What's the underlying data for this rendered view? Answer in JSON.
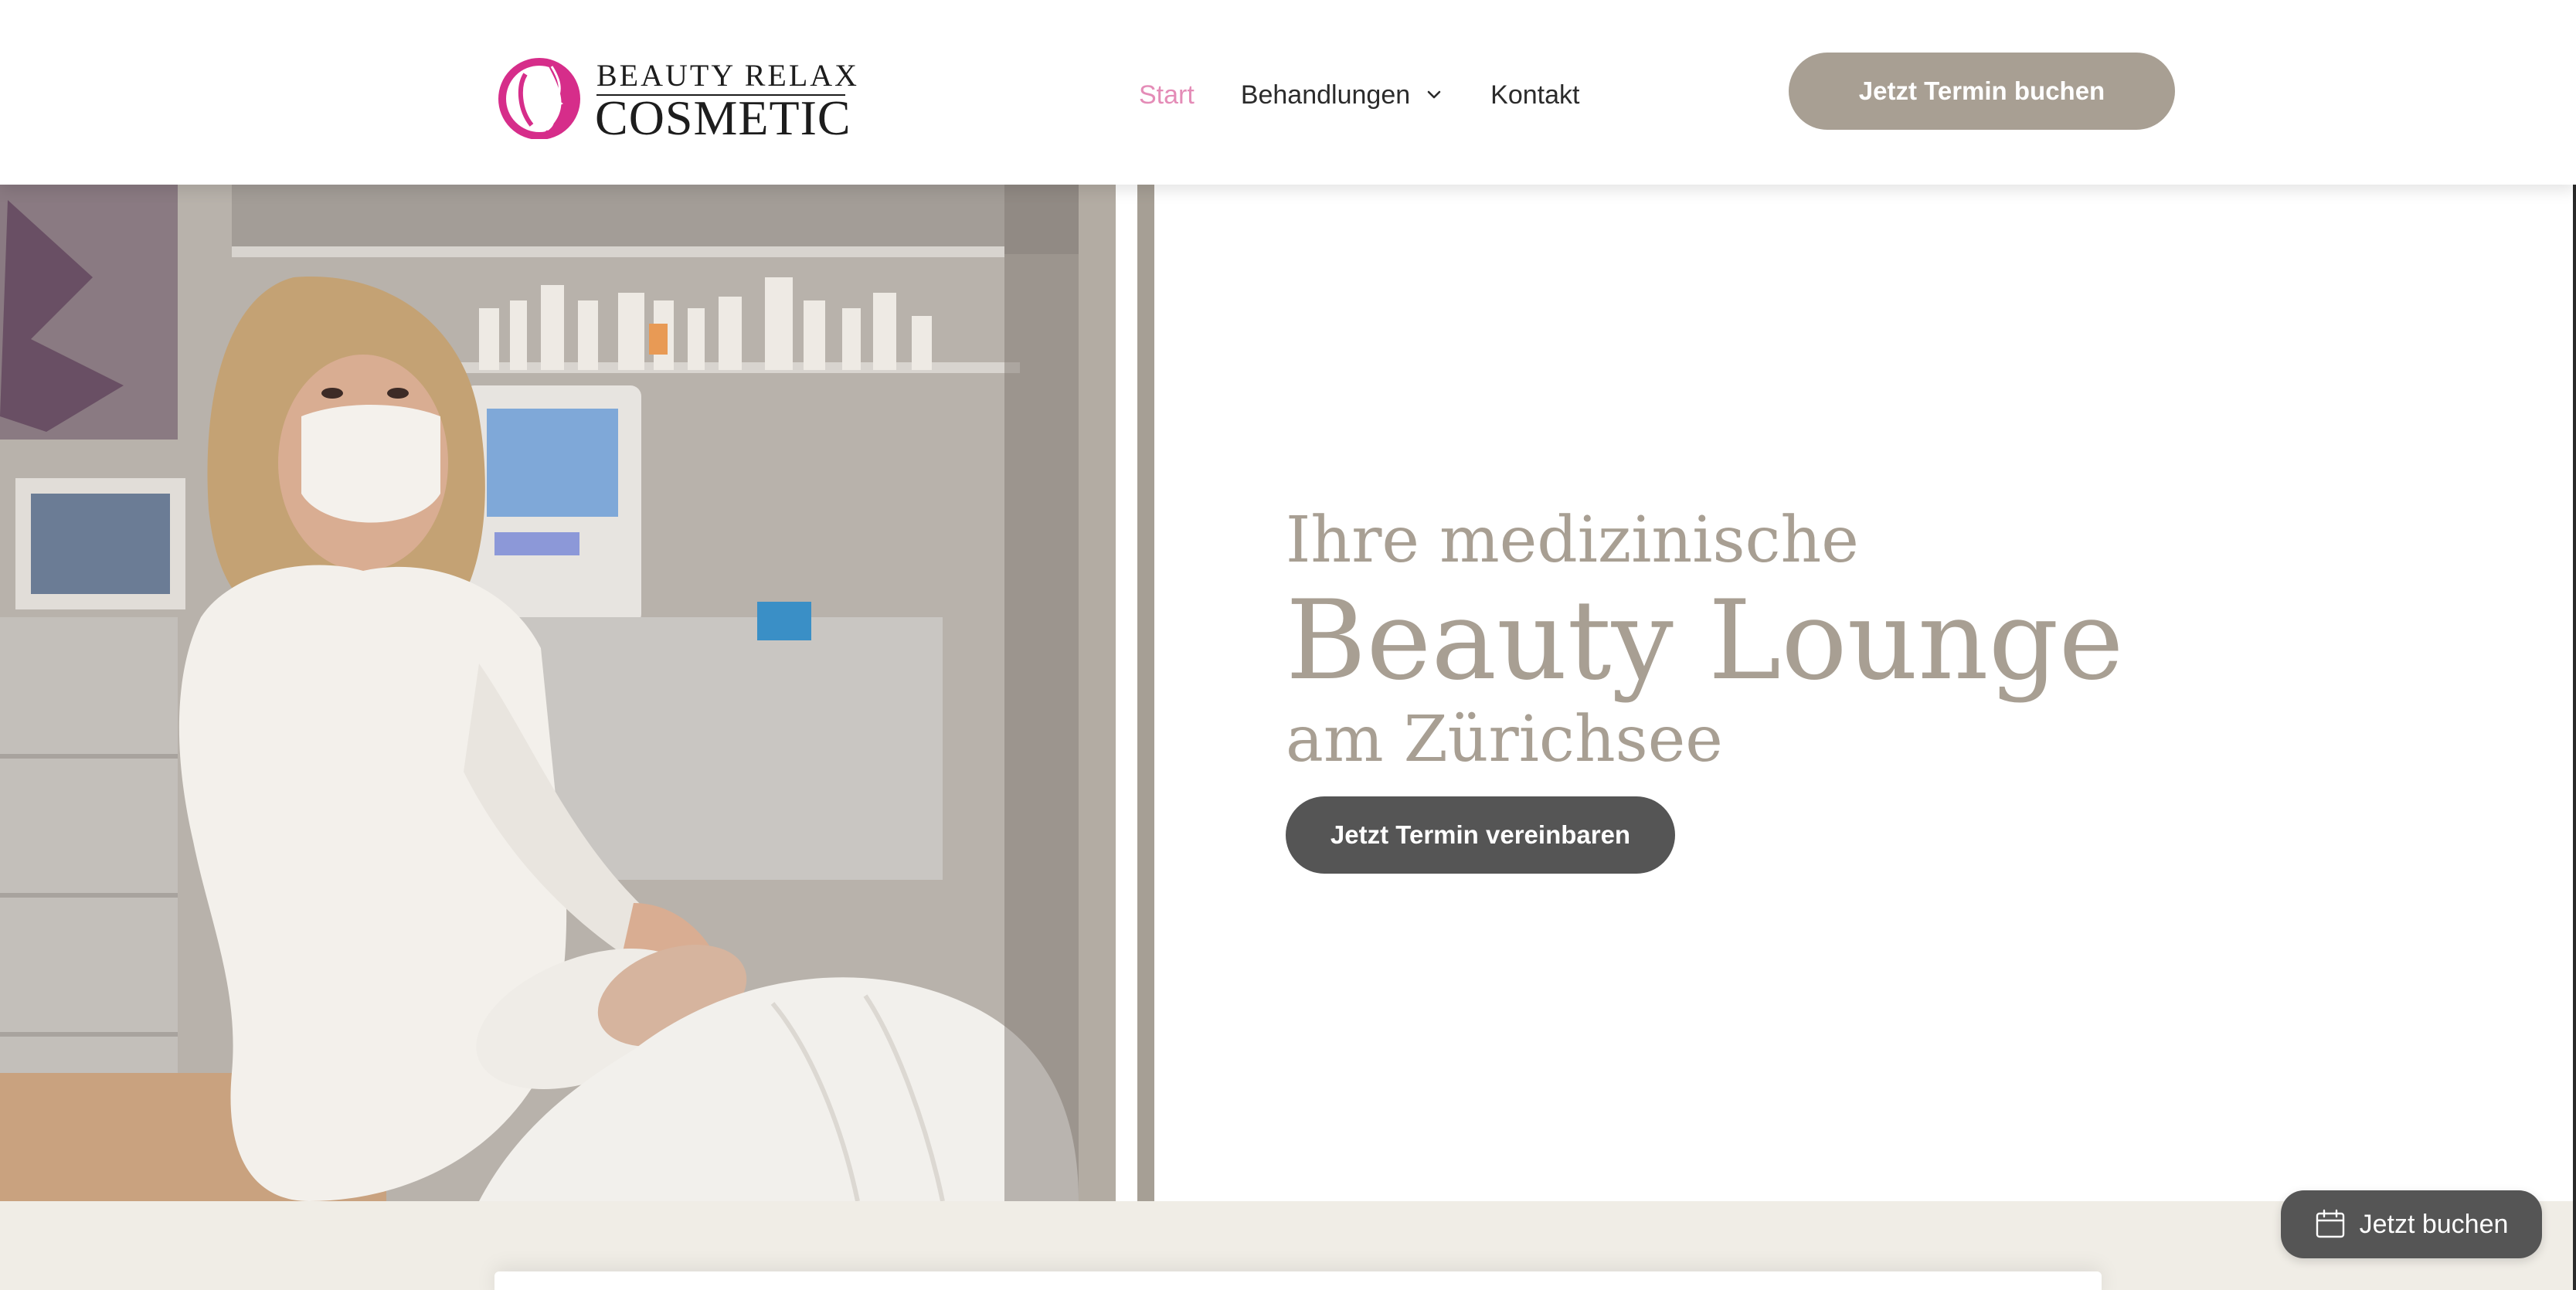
{
  "brand": {
    "logo_line1": "BEAUTY RELAX",
    "logo_line2": "COSMETIC",
    "accent_color": "#d62d8a"
  },
  "nav": {
    "items": [
      {
        "label": "Start",
        "active": true
      },
      {
        "label": "Behandlungen",
        "has_dropdown": true
      },
      {
        "label": "Kontakt"
      }
    ],
    "active_color": "#e48cb7"
  },
  "header": {
    "cta_label": "Jetzt Termin buchen",
    "cta_color": "#a89f93"
  },
  "hero": {
    "headline_line1": "Ihre medizinische",
    "headline_line2": "Beauty Lounge",
    "headline_line3": "am Zürichsee",
    "cta_label": "Jetzt Termin vereinbaren",
    "text_color": "#a89f93",
    "cta_color": "#555555",
    "image_icon": "photo-beautician-facial-treatment"
  },
  "floating_widget": {
    "label": "Jetzt buchen",
    "icon": "calendar-icon"
  }
}
